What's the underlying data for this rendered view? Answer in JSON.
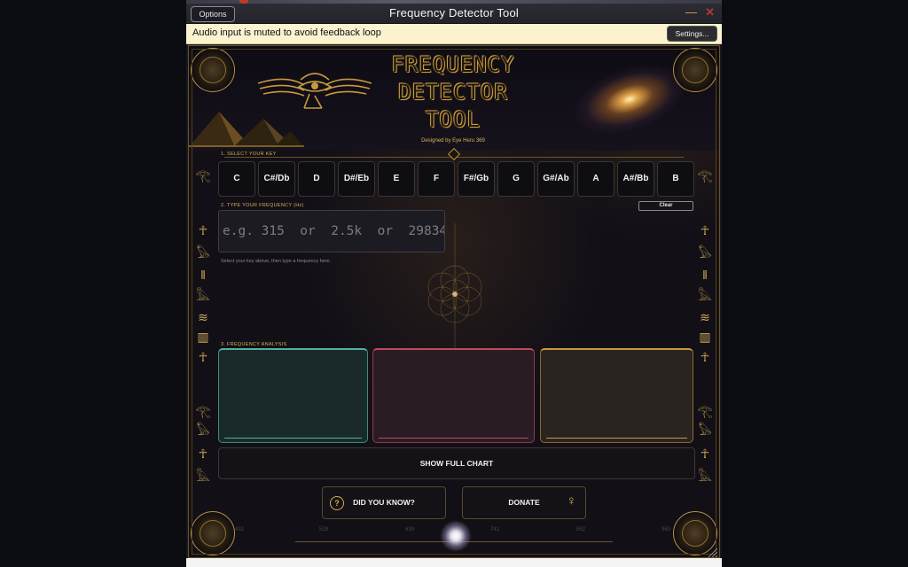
{
  "window": {
    "title": "Frequency Detector Tool",
    "options_label": "Options",
    "minimize_glyph": "—",
    "close_glyph": "✕"
  },
  "banner": {
    "message": "Audio input is muted to avoid feedback loop",
    "settings_label": "Settings..."
  },
  "header": {
    "title_line1": "FREQUENCY",
    "title_line2": "DETECTOR",
    "title_line3": "TOOL",
    "designer": "Designed by Eye Heru 369",
    "emblem": "eye-of-horus-winged-icon",
    "left_art": "pyramids-icon",
    "right_art": "galaxy-icon"
  },
  "sections": {
    "select_key": "1.  SELECT YOUR KEY",
    "type_frequency": "2.  TYPE YOUR FREQUENCY (Hz)",
    "analysis": "3.  FREQUENCY ANALYSIS"
  },
  "keys": [
    "C",
    "C#/Db",
    "D",
    "D#/Eb",
    "E",
    "F",
    "F#/Gb",
    "G",
    "G#/Ab",
    "A",
    "A#/Bb",
    "B"
  ],
  "clear_label": "Clear",
  "frequency_input": {
    "value": "",
    "placeholder": "e.g. 315  or  2.5k  or  29834"
  },
  "hint": "Select your key above, then type a frequency here.",
  "panels": [
    {
      "name": "teal",
      "color": "#4fb39f"
    },
    {
      "name": "red",
      "color": "#c04a56"
    },
    {
      "name": "gold",
      "color": "#c99a3a"
    }
  ],
  "show_chart_label": "SHOW FULL CHART",
  "did_you_know_label": "DID YOU KNOW?",
  "donate_label": "DONATE",
  "scale_numbers": [
    "432",
    "528",
    "639",
    "741",
    "852",
    "963"
  ],
  "side_glyphs": [
    "eye-of-ra-icon",
    "ankh-icon",
    "falcon-icon",
    "reed-icon",
    "bird-icon",
    "lotus-icon",
    "pillar-icon",
    "ankh-icon",
    "eye-of-ra-icon",
    "falcon-icon",
    "ankh-icon",
    "bird-icon"
  ],
  "colors": {
    "accent_gold": "#d5b04f",
    "banner_bg": "#fbf2cf",
    "app_bg": "#120f17"
  }
}
